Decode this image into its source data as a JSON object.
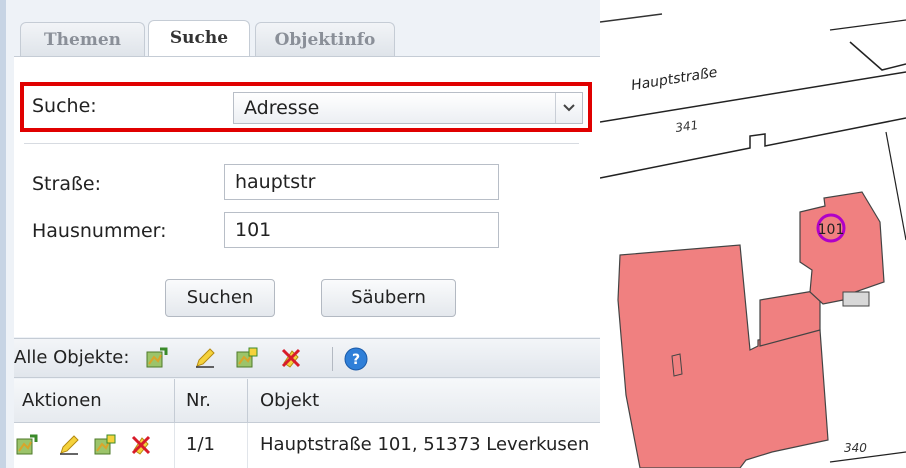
{
  "tabs": [
    {
      "label": "Themen",
      "active": false
    },
    {
      "label": "Suche",
      "active": true
    },
    {
      "label": "Objektinfo",
      "active": false
    }
  ],
  "search": {
    "type_label": "Suche:",
    "type_value": "Adresse",
    "street_label": "Straße:",
    "street_value": "hauptstr",
    "housenumber_label": "Hausnummer:",
    "housenumber_value": "101",
    "search_button": "Suchen",
    "clear_button": "Säubern"
  },
  "toolbar": {
    "label": "Alle Objekte:",
    "icons": [
      "zoom-to-map-icon",
      "edit-pencil-icon",
      "map-select-icon",
      "delete-icon",
      "help-icon"
    ]
  },
  "results": {
    "columns": [
      "Aktionen",
      "Nr.",
      "Objekt"
    ],
    "rows": [
      {
        "nr": "1/1",
        "objekt": "Hauptstraße 101, 51373 Leverkusen"
      }
    ]
  },
  "map": {
    "street_label": "Hauptstraße",
    "parcel_labels": [
      "341",
      "340"
    ],
    "marker_label": "101"
  },
  "colors": {
    "highlight_frame": "#e00000",
    "building_fill": "#f08080",
    "marker": "#b000c8"
  }
}
